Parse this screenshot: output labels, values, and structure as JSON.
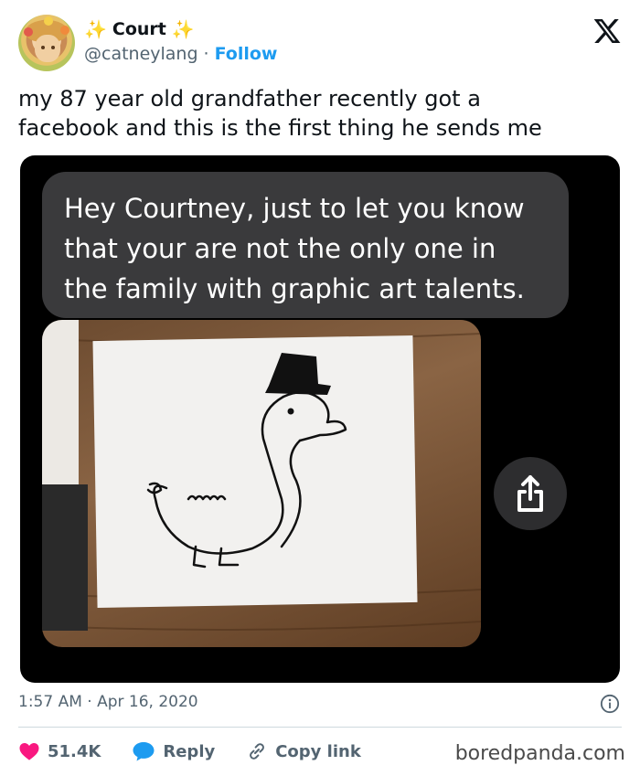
{
  "user": {
    "display_name": "Court",
    "sparkle_left": "✨",
    "sparkle_right": "✨",
    "handle": "@catneylang",
    "separator": "·",
    "follow_label": "Follow"
  },
  "tweet": {
    "text_line1": "my 87 year old grandfather recently got a",
    "text_line2": "facebook and this is the first thing he sends me"
  },
  "media": {
    "message_line1": "Hey Courtney, just to let you know",
    "message_line2": "that your are not the only one in",
    "message_line3": "the family with graphic art talents."
  },
  "meta": {
    "timestamp": "1:57 AM · Apr 16, 2020"
  },
  "actions": {
    "like_count": "51.4K",
    "reply_label": "Reply",
    "copy_label": "Copy link"
  },
  "watermark": "boredpanda.com",
  "colors": {
    "accent": "#1d9bf0",
    "like": "#f91880",
    "text_secondary": "#536471",
    "bubble": "#3a3a3c"
  },
  "icons": {
    "close": "x-logo-icon",
    "info": "info-icon",
    "like": "heart-icon",
    "reply": "speech-bubble-icon",
    "copy": "link-icon",
    "share": "share-icon"
  }
}
